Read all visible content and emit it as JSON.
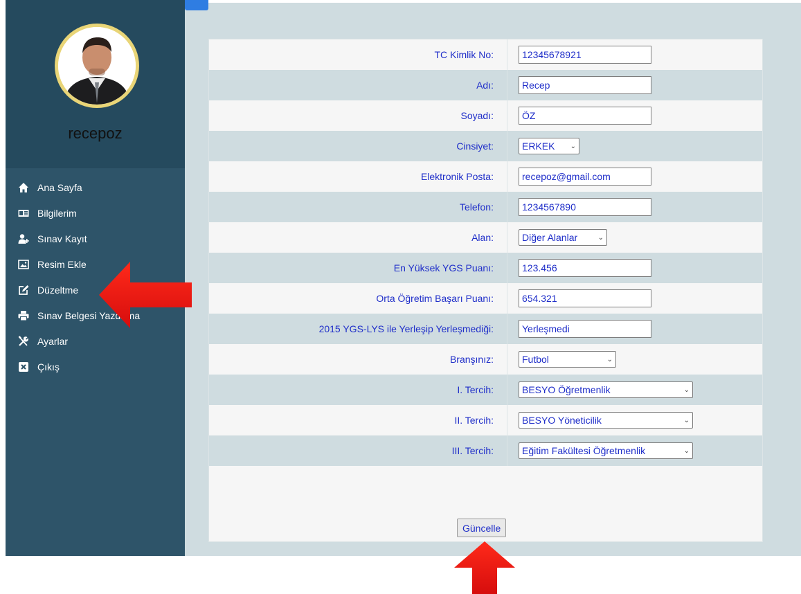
{
  "sidebar": {
    "username": "recepoz",
    "menu": [
      {
        "label": "Ana Sayfa",
        "icon": "home-icon"
      },
      {
        "label": "Bilgilerim",
        "icon": "id-card-icon"
      },
      {
        "label": "Sınav Kayıt",
        "icon": "user-plus-icon"
      },
      {
        "label": "Resim Ekle",
        "icon": "image-icon"
      },
      {
        "label": "Düzeltme",
        "icon": "edit-icon"
      },
      {
        "label": "Sınav Belgesi Yazdırma",
        "icon": "print-icon"
      },
      {
        "label": "Ayarlar",
        "icon": "tools-icon"
      },
      {
        "label": "Çıkış",
        "icon": "close-box-icon"
      }
    ]
  },
  "form": {
    "fields": [
      {
        "label": "TC Kimlik No:",
        "value": "12345678921",
        "kind": "text"
      },
      {
        "label": "Adı:",
        "value": "Recep",
        "kind": "text"
      },
      {
        "label": "Soyadı:",
        "value": "ÖZ",
        "kind": "text"
      },
      {
        "label": "Cinsiyet:",
        "value": "ERKEK",
        "kind": "select"
      },
      {
        "label": "Elektronik Posta:",
        "value": "recepoz@gmail.com",
        "kind": "text"
      },
      {
        "label": "Telefon:",
        "value": "1234567890",
        "kind": "text"
      },
      {
        "label": "Alan:",
        "value": "Diğer Alanlar",
        "kind": "select"
      },
      {
        "label": "En Yüksek YGS Puanı:",
        "value": "123.456",
        "kind": "text"
      },
      {
        "label": "Orta Öğretim Başarı Puanı:",
        "value": "654.321",
        "kind": "text"
      },
      {
        "label": "2015 YGS-LYS ile Yerleşip Yerleşmediği:",
        "value": "Yerleşmedi",
        "kind": "text"
      },
      {
        "label": "Branşınız:",
        "value": "Futbol",
        "kind": "select"
      },
      {
        "label": "I. Tercih:",
        "value": "BESYO Öğretmenlik",
        "kind": "select"
      },
      {
        "label": "II. Tercih:",
        "value": "BESYO Yöneticilik",
        "kind": "select"
      },
      {
        "label": "III. Tercih:",
        "value": "Eğitim Fakültesi Öğretmenlik",
        "kind": "select"
      }
    ],
    "submit_label": "Güncelle"
  },
  "colors": {
    "sidebar": "#2e5469",
    "profile": "#254a5e",
    "label_text": "#1f2ec9",
    "row_alt": "#cfdce0",
    "arrow": "#e81010"
  }
}
